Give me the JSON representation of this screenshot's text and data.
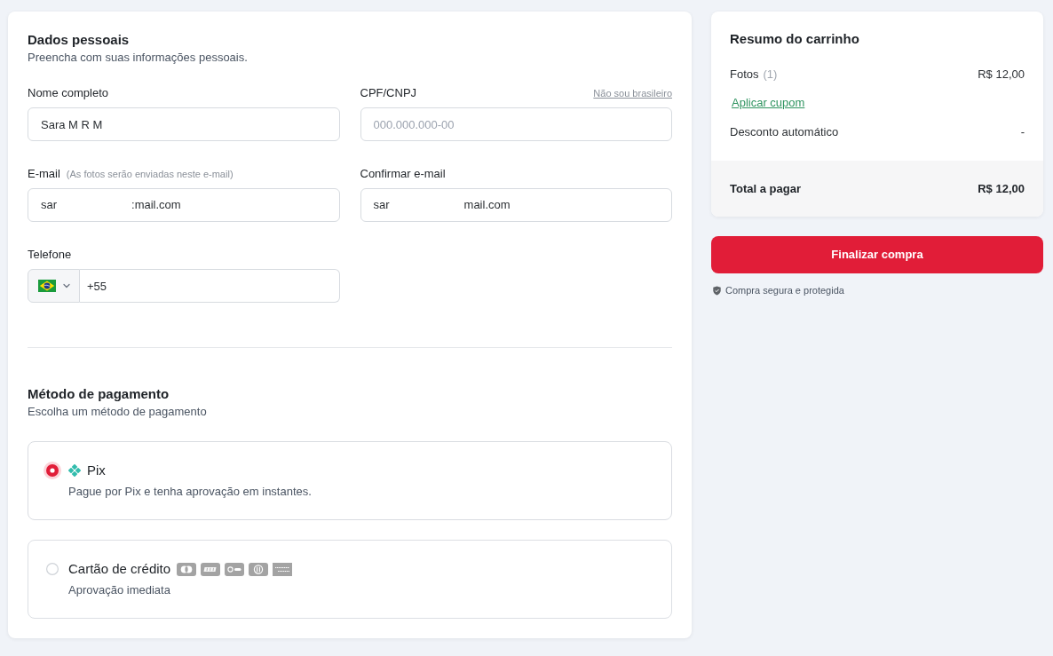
{
  "personal_data": {
    "title": "Dados pessoais",
    "subtitle": "Preencha com suas informações pessoais.",
    "fields": [
      {
        "kind": "text",
        "label": "Nome completo",
        "value": "Sara M R M"
      },
      {
        "kind": "text",
        "label": "CPF/CNPJ",
        "link": "Não sou brasileiro",
        "placeholder": "000.000.000-00"
      },
      {
        "kind": "email",
        "label": "E-mail",
        "hint": "(As fotos serão enviadas neste e-mail)",
        "value_parts": [
          "sar",
          ":mail.com"
        ]
      },
      {
        "kind": "email",
        "label": "Confirmar e-mail",
        "value_parts": [
          "sar",
          "mail.com"
        ]
      },
      {
        "kind": "phone",
        "label": "Telefone",
        "value": "+55"
      }
    ]
  },
  "payment": {
    "title": "Método de pagamento",
    "subtitle": "Escolha um método de pagamento",
    "options": [
      {
        "kind": "pix",
        "label": "Pix",
        "description": "Pague por Pix e tenha aprovação em instantes.",
        "selected": true
      },
      {
        "kind": "card",
        "label": "Cartão de crédito",
        "description": "Aprovação imediata",
        "selected": false
      }
    ]
  },
  "cart_summary": {
    "title": "Resumo do carrinho",
    "items": [
      {
        "label": "Fotos",
        "count": "(1)",
        "price": "R$ 12,00"
      }
    ],
    "coupon_link": "Aplicar cupom",
    "discount": {
      "label": "Desconto automático",
      "value": "-"
    },
    "total": {
      "label": "Total a pagar",
      "value": "R$ 12,00"
    }
  },
  "checkout_button": "Finalizar compra",
  "security_note": "Compra segura e protegida"
}
